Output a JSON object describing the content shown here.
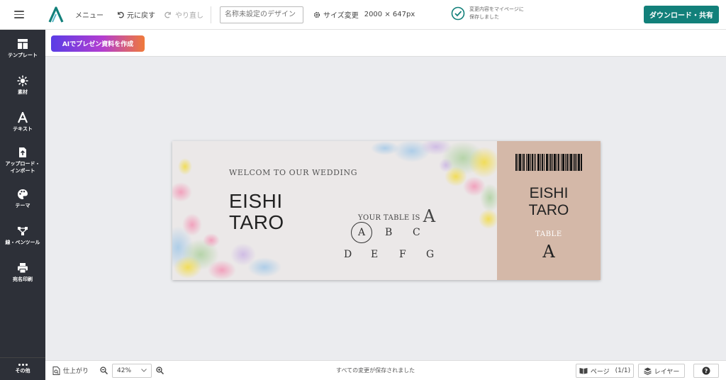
{
  "topbar": {
    "menu_label": "メニュー",
    "undo_label": "元に戻す",
    "redo_label": "やり直し",
    "title_placeholder": "名称未設定のデザイン",
    "size_label": "サイズ変更",
    "size_value": "2000 × 647px",
    "save_status_line1": "変更内容をマイページに",
    "save_status_line2": "保存しました",
    "download_label": "ダウンロード・共有"
  },
  "sidebar": {
    "items": [
      {
        "label": "テンプレート",
        "icon": "template-icon"
      },
      {
        "label": "素材",
        "icon": "materials-icon"
      },
      {
        "label": "テキスト",
        "icon": "text-icon"
      },
      {
        "label_line1": "アップロード・",
        "label_line2": "インポート",
        "icon": "upload-icon"
      },
      {
        "label": "テーマ",
        "icon": "palette-icon"
      },
      {
        "label": "線・ペンツール",
        "icon": "pen-tool-icon"
      },
      {
        "label": "宛名印刷",
        "icon": "printer-icon"
      }
    ],
    "more_label": "その他"
  },
  "subbar": {
    "ai_button_label": "AIでプレゼン資料を作成"
  },
  "ticket": {
    "welcome": "WELCOM TO OUR WEDDING",
    "name_line1": "EISHI",
    "name_line2": "TARO",
    "your_table_prefix": "YOUR TABLE IS",
    "your_table_letter": "A",
    "tables_row1": [
      "A",
      "B",
      "C"
    ],
    "tables_row2": [
      "D",
      "E",
      "F",
      "G"
    ],
    "stub_name_line1": "EISHI",
    "stub_name_line2": "TARO",
    "stub_table_label": "TABLE",
    "stub_table_letter": "A"
  },
  "bottombar": {
    "finish_label": "仕上がり",
    "zoom_value": "42%",
    "saved_message": "すべての変更が保存されました",
    "pages_label": "ページ",
    "pages_count": "(1/1)",
    "layer_label": "レイヤー"
  },
  "colors": {
    "accent": "#12807a",
    "sidebar_bg": "#2d3038",
    "stub_bg": "#d4b8a8"
  }
}
